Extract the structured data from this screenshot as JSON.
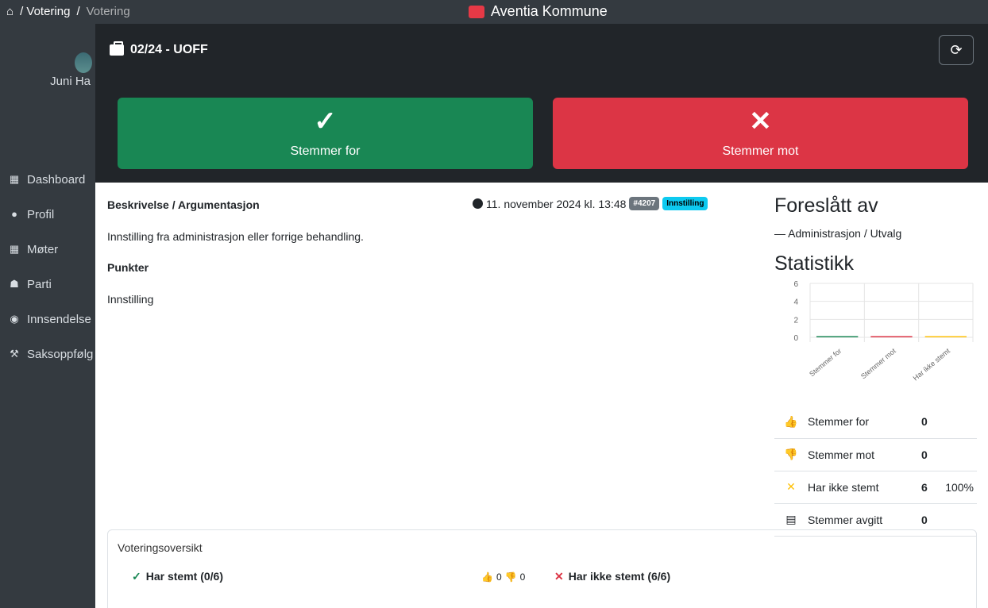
{
  "topbar": {
    "breadcrumb": [
      "/ Votering",
      "/",
      "Votering"
    ],
    "brand": "Aventia Kommune"
  },
  "sidebar": {
    "user_name": "Juni Ha",
    "items": [
      {
        "label": "Dashboard",
        "icon": "dashboard-icon"
      },
      {
        "label": "Profil",
        "icon": "user-icon"
      },
      {
        "label": "Møter",
        "icon": "meetings-icon"
      },
      {
        "label": "Parti",
        "icon": "party-icon"
      },
      {
        "label": "Innsendelse",
        "icon": "comment-icon"
      },
      {
        "label": "Saksoppfølg",
        "icon": "gavel-icon"
      }
    ]
  },
  "modal": {
    "title": "02/24 - UOFF",
    "vote_for_label": "Stemmer for",
    "vote_against_label": "Stemmer mot",
    "colors": {
      "for": "#198754",
      "against": "#dc3545",
      "header": "#212529"
    }
  },
  "body": {
    "desc_title": "Beskrivelse / Argumentasjon",
    "date": "11. november 2024 kl. 13:48",
    "badge_id": "#4207",
    "badge_type": "Innstilling",
    "desc_text": "Innstilling fra administrasjon eller forrige behandling.",
    "points_title": "Punkter",
    "points_text": "Innstilling"
  },
  "right": {
    "proposed_title": "Foreslått av",
    "proposed_by": "— Administrasjon / Utvalg",
    "stats_title": "Statistikk",
    "rows": [
      {
        "label": "Stemmer for",
        "value": "0",
        "pct": ""
      },
      {
        "label": "Stemmer mot",
        "value": "0",
        "pct": ""
      },
      {
        "label": "Har ikke stemt",
        "value": "6",
        "pct": "100%"
      },
      {
        "label": "Stemmer avgitt",
        "value": "0",
        "pct": ""
      }
    ]
  },
  "chart_data": {
    "type": "bar",
    "categories": [
      "Stemmer for",
      "Stemmer mot",
      "Har ikke stemt"
    ],
    "values": [
      0,
      0,
      0
    ],
    "ylim": [
      0,
      6
    ],
    "yticks": [
      "6",
      "4",
      "2",
      "0"
    ],
    "colors": [
      "#198754",
      "#dc3545",
      "#ffc107"
    ]
  },
  "overview": {
    "title": "Voteringsoversikt",
    "voted_label": "Har stemt (0/6)",
    "count_for": "0",
    "count_against": "0",
    "not_voted_label": "Har ikke stemt (6/6)"
  }
}
